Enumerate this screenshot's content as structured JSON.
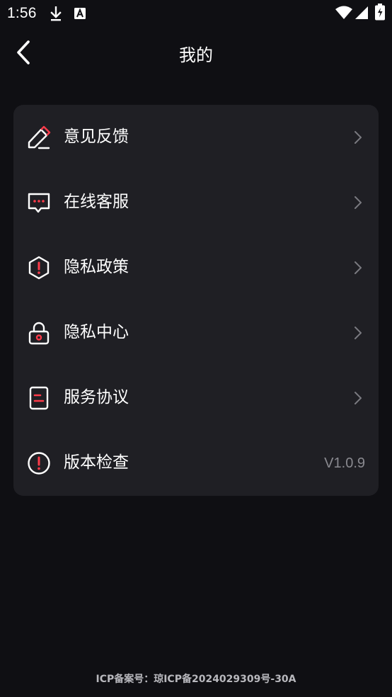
{
  "status_bar": {
    "time": "1:56"
  },
  "header": {
    "title": "我的"
  },
  "menu": {
    "items": [
      {
        "label": "意见反馈",
        "icon": "edit-icon"
      },
      {
        "label": "在线客服",
        "icon": "chat-icon"
      },
      {
        "label": "隐私政策",
        "icon": "shield-icon"
      },
      {
        "label": "隐私中心",
        "icon": "lock-icon"
      },
      {
        "label": "服务协议",
        "icon": "document-icon"
      },
      {
        "label": "版本检查",
        "icon": "info-icon",
        "value": "V1.0.9"
      }
    ]
  },
  "footer": {
    "icp": "ICP备案号：琼ICP备2024029309号-30A"
  },
  "colors": {
    "background": "#0f0f13",
    "card": "#1f1f24",
    "accent": "#ff3b4a",
    "text": "#ffffff",
    "muted": "#8a8a90"
  }
}
